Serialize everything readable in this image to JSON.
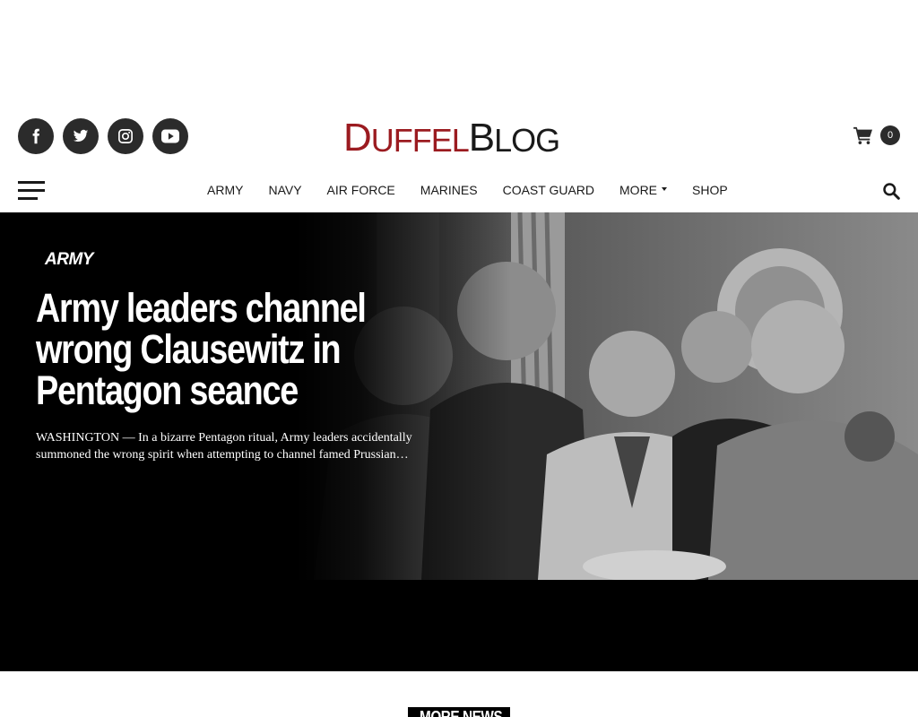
{
  "site": {
    "logo": {
      "part1_big": "D",
      "part1_small": "UFFEL",
      "part2_big": "B",
      "part2_small": "LOG"
    }
  },
  "social": [
    {
      "name": "facebook-icon"
    },
    {
      "name": "twitter-icon"
    },
    {
      "name": "instagram-icon"
    },
    {
      "name": "youtube-icon"
    }
  ],
  "cart": {
    "count": "0"
  },
  "nav": {
    "items": [
      {
        "label": "Army"
      },
      {
        "label": "Navy"
      },
      {
        "label": "Air Force"
      },
      {
        "label": "Marines"
      },
      {
        "label": "Coast Guard"
      },
      {
        "label": "More",
        "has_dropdown": true
      },
      {
        "label": "Shop"
      }
    ]
  },
  "hero": {
    "category": "ARMY",
    "title": "Army leaders channel wrong Clausewitz in Pentagon seance",
    "excerpt": "WASHINGTON — In a bizarre Pentagon ritual, Army leaders accidentally summoned the wrong spirit when attempting to channel famed Prussian…"
  },
  "section": {
    "more_news": "MORE NEWS"
  },
  "colors": {
    "brand_red": "#9b1b20",
    "dark": "#2b2b2b",
    "hero_bg": "#000000"
  }
}
